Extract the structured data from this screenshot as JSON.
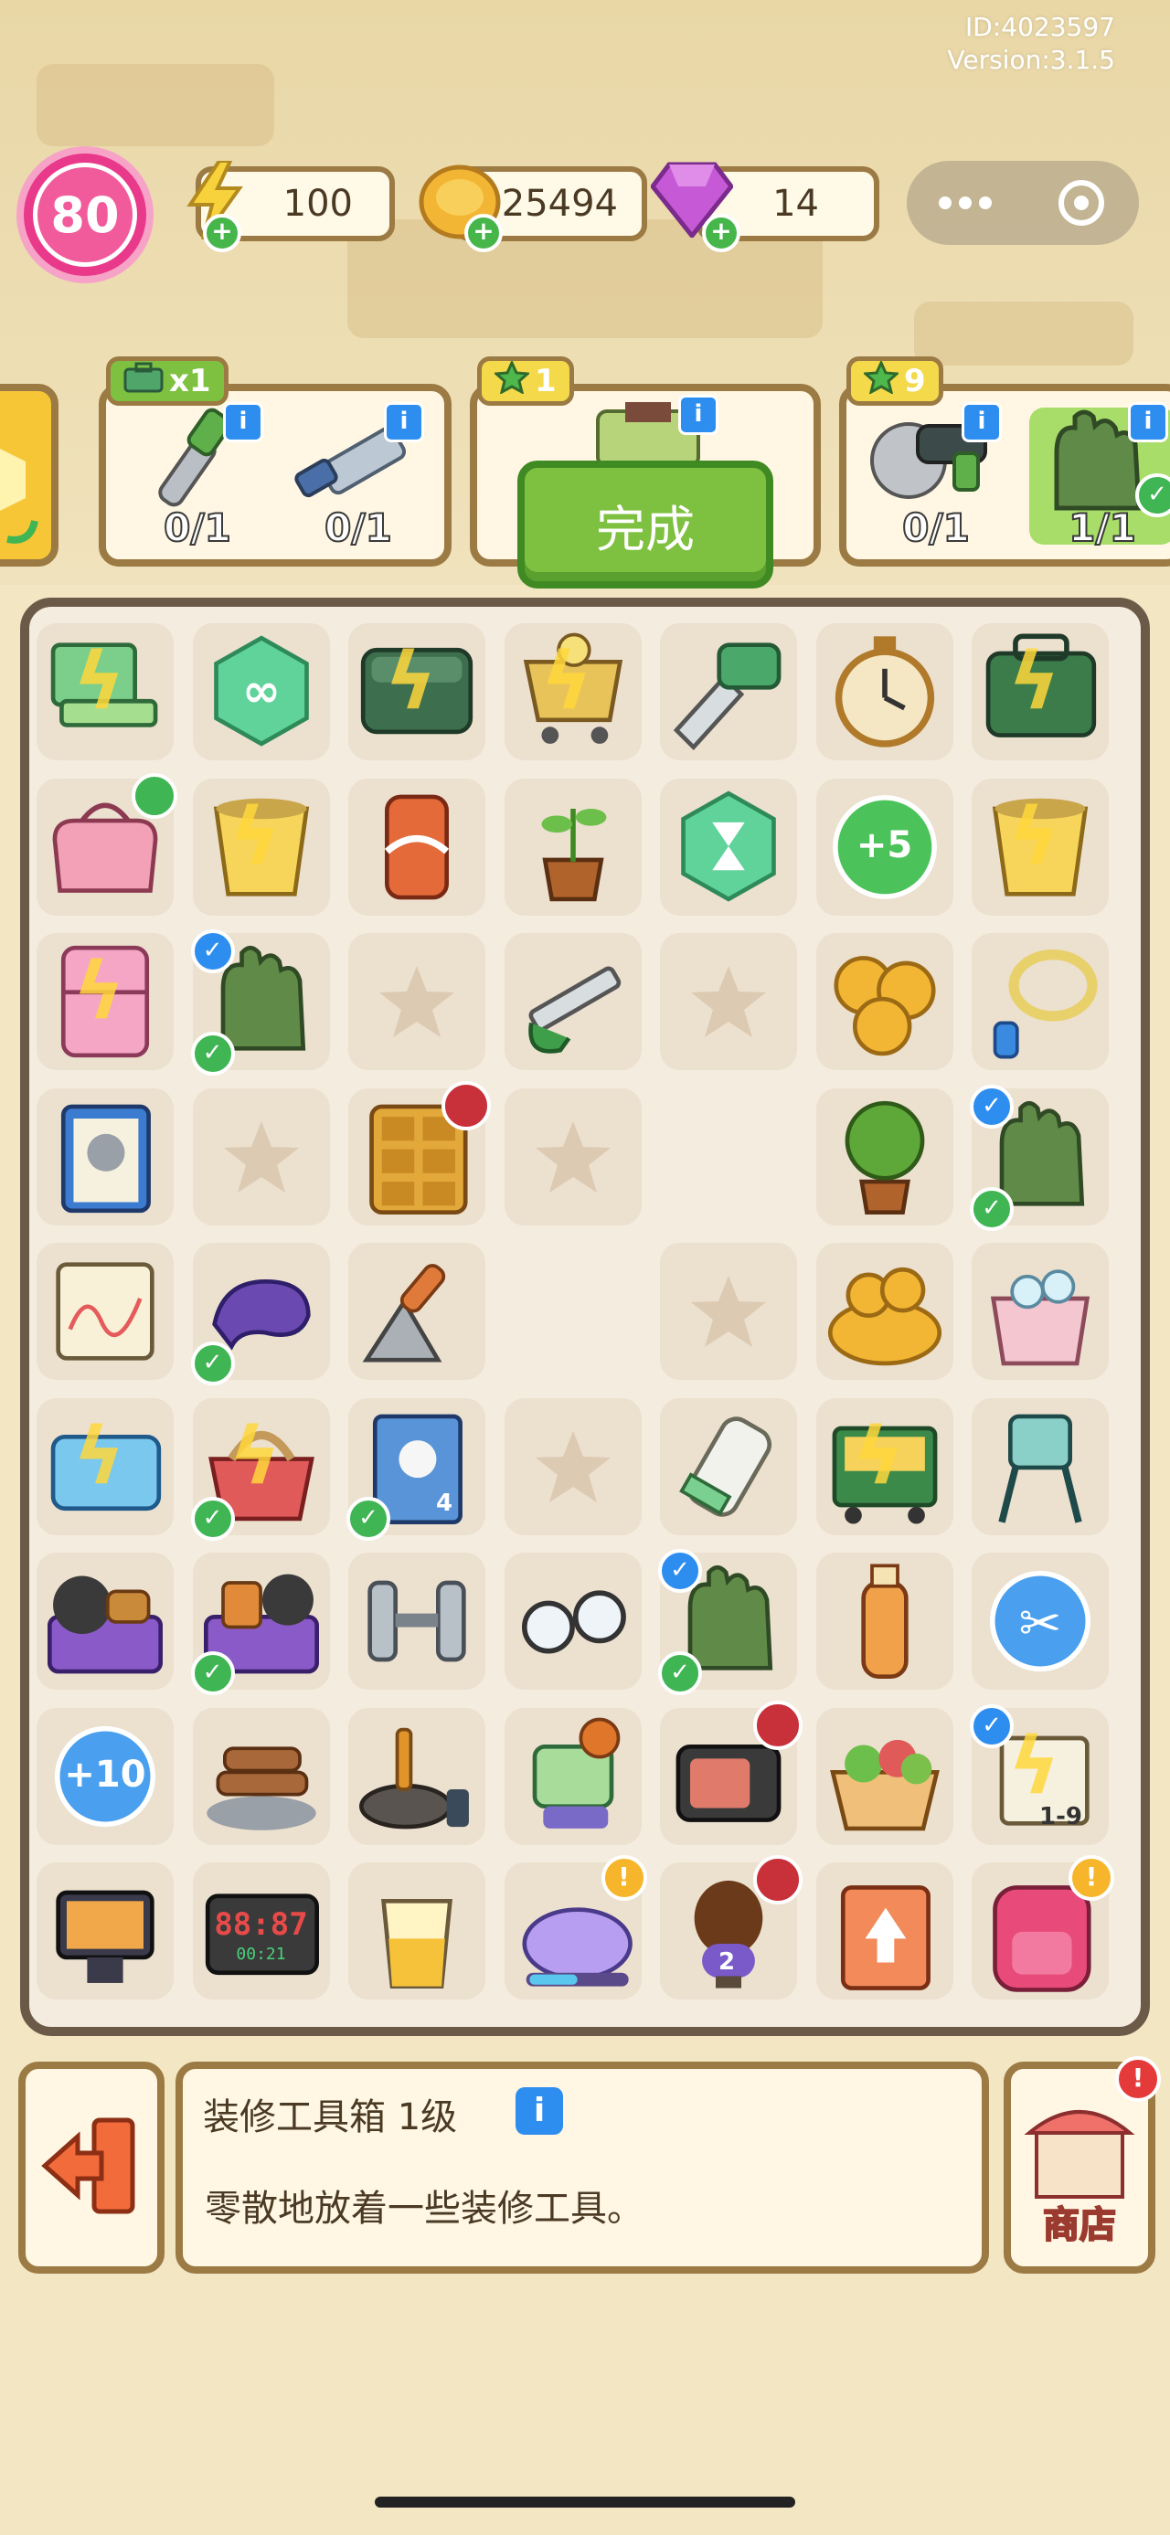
{
  "header": {
    "id_text": "ID:4023597",
    "version_text": "Version:3.1.5",
    "level": "80",
    "energy": "100",
    "coins": "25494",
    "gems": "14",
    "energy_icon": "lightning-icon",
    "coin_icon": "coin-icon",
    "gem_icon": "gem-icon",
    "menu_icon": "more-dots-icon",
    "target_icon": "target-icon"
  },
  "orders": [
    {
      "reward": "x1",
      "reward_icon": "toolbox-icon",
      "requirements": [
        {
          "item": "wrench",
          "count": "0/1"
        },
        {
          "item": "file-tool",
          "count": "0/1"
        }
      ]
    },
    {
      "reward": "1",
      "reward_icon": "star-icon",
      "requirements": [
        {
          "item": "toolbox",
          "count": ""
        }
      ],
      "action": "完成"
    },
    {
      "reward": "9",
      "reward_icon": "star-icon",
      "requirements": [
        {
          "item": "angle-grinder",
          "count": "0/1"
        },
        {
          "item": "gloves",
          "count": "1/1"
        }
      ]
    }
  ],
  "board": {
    "rows": [
      [
        "laptop",
        "infinity-hex",
        "toolbox-chest",
        "shopping-cart",
        "drill-saw",
        "stopwatch",
        "green-toolbox"
      ],
      [
        "pink-bag",
        "bucket",
        "soda-can",
        "sprout-pot",
        "hourglass-hex",
        "plus5",
        "bucket"
      ],
      [
        "fridge",
        "gloves",
        "empty",
        "hacksaw",
        "empty",
        "coin-pile",
        "jump-rope"
      ],
      [
        "clipboard",
        "empty",
        "cabinet",
        "empty",
        "blank",
        "potted-tree",
        "gloves"
      ],
      [
        "chart-paper",
        "goggles",
        "trowel",
        "blank",
        "empty",
        "coin-heap",
        "ice-bucket"
      ],
      [
        "mop-box",
        "fruit-basket",
        "book",
        "empty",
        "hair-clipper",
        "cart-crates",
        "high-chair"
      ],
      [
        "weights-crate",
        "basket-gear",
        "dumbbells",
        "glasses",
        "gloves",
        "bottle",
        "scissors-bubble"
      ],
      [
        "plus10",
        "firewood",
        "pan-spatula",
        "robot-vendor",
        "camera",
        "salad-box",
        "sticky-note"
      ],
      [
        "tablet-display",
        "alarm-clock",
        "juice-glass",
        "unicorn-float",
        "trophy-bust",
        "ticket-card",
        "backpack"
      ]
    ],
    "labels": {
      "plus5": "+5",
      "plus10": "+10",
      "alarm_clock": "88:87",
      "alarm_clock_sub": "00:21",
      "book_number": "4",
      "trophy_number": "2",
      "sticky_note": "1-9"
    }
  },
  "footer": {
    "item_name": "装修工具箱 1级",
    "item_description": "零散地放着一些装修工具。",
    "shop_label": "商店",
    "exit_icon": "exit-door-icon",
    "info_icon": "info-icon"
  }
}
